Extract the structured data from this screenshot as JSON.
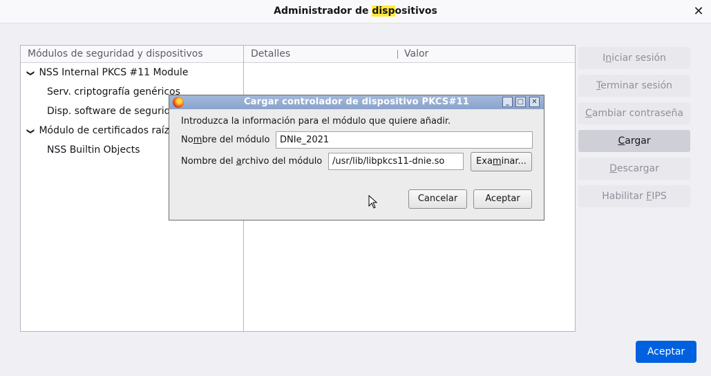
{
  "window": {
    "title_prefix": "Administrador de ",
    "title_highlight": "disp",
    "title_suffix": "ositivos",
    "close_glyph": "✕"
  },
  "tree": {
    "header": "Módulos de seguridad y dispositivos",
    "items": [
      {
        "label": "NSS Internal PKCS #11 Module",
        "expanded": true
      },
      {
        "label": "Serv. criptografía genéricos"
      },
      {
        "label": "Disp. software de seguridad"
      },
      {
        "label": "Módulo de certificados raíz",
        "expanded": true
      },
      {
        "label": "NSS Builtin Objects"
      }
    ]
  },
  "details": {
    "col_details": "Detalles",
    "col_value": "Valor"
  },
  "side_buttons": {
    "login": {
      "pre": "I",
      "acc": "n",
      "post": "iciar sesión"
    },
    "logout": {
      "pre": "",
      "acc": "T",
      "post": "erminar sesión"
    },
    "change_pw": {
      "pre": "",
      "acc": "C",
      "post": "ambiar contraseña"
    },
    "load": {
      "pre": "",
      "acc": "C",
      "post": "argar"
    },
    "unload": {
      "pre": "",
      "acc": "D",
      "post": "escargar"
    },
    "fips": {
      "pre": "Habilitar ",
      "acc": "F",
      "post": "IPS"
    }
  },
  "ok_button": "Aceptar",
  "dialog": {
    "title": "Cargar controlador de dispositivo PKCS#11",
    "intro": "Introduzca la información para el módulo que quiere añadir.",
    "module_name_label": {
      "pre": "No",
      "acc": "m",
      "post": "bre del módulo"
    },
    "module_name_value": "DNIe_2021",
    "file_label": {
      "pre": "Nombre del ",
      "acc": "a",
      "post": "rchivo del módulo"
    },
    "file_value": "/usr/lib/libpkcs11-dnie.so",
    "browse": {
      "pre": "Exa",
      "acc": "m",
      "post": "inar..."
    },
    "cancel": "Cancelar",
    "accept": "Aceptar",
    "minimize_glyph": "_",
    "maximize_glyph": "□",
    "close_glyph": "✕"
  },
  "colors": {
    "accent": "#0061e0",
    "highlight": "#ffeb3b",
    "dialog_titlebar": "#8ba4cc"
  }
}
